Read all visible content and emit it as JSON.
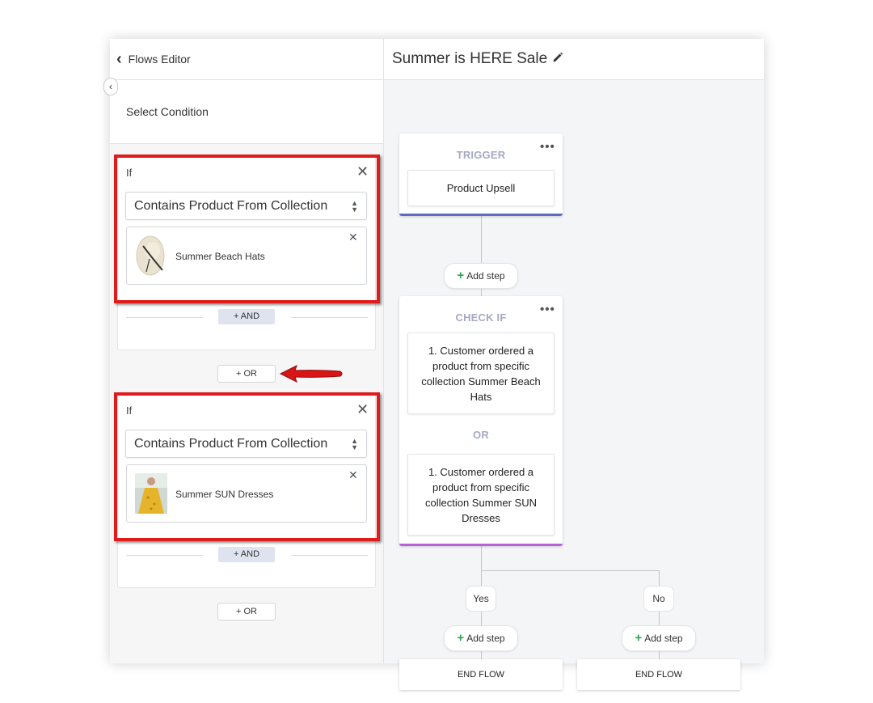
{
  "left_panel": {
    "back_label": "Flows Editor",
    "select_condition_label": "Select Condition",
    "groups": [
      {
        "if_label": "If",
        "condition_select": "Contains Product From Collection",
        "collection_name": "Summer Beach Hats",
        "and_label": "+ AND"
      },
      {
        "if_label": "If",
        "condition_select": "Contains Product From Collection",
        "collection_name": "Summer SUN Dresses",
        "and_label": "+ AND"
      }
    ],
    "or_label": "+ OR"
  },
  "flow": {
    "title": "Summer is HERE Sale",
    "trigger": {
      "title": "TRIGGER",
      "item": "Product Upsell"
    },
    "add_step_label": "Add step",
    "check_if": {
      "title": "CHECK IF",
      "conditions": [
        "1. Customer ordered a product from specific collection  Summer Beach Hats",
        "1. Customer ordered a product from specific collection  Summer SUN Dresses"
      ],
      "or_label": "OR"
    },
    "branches": {
      "yes": "Yes",
      "no": "No"
    },
    "end_label": "END FLOW"
  },
  "colors": {
    "highlight_red": "#e01b1b",
    "trigger_accent": "#5c6ac4",
    "check_accent": "#b763d8",
    "plus_green": "#2ea44f"
  },
  "icons": [
    "chevron-left-icon",
    "close-icon",
    "select-arrows-icon",
    "pencil-icon",
    "more-dots-icon",
    "plus-icon",
    "arrow-icon"
  ]
}
